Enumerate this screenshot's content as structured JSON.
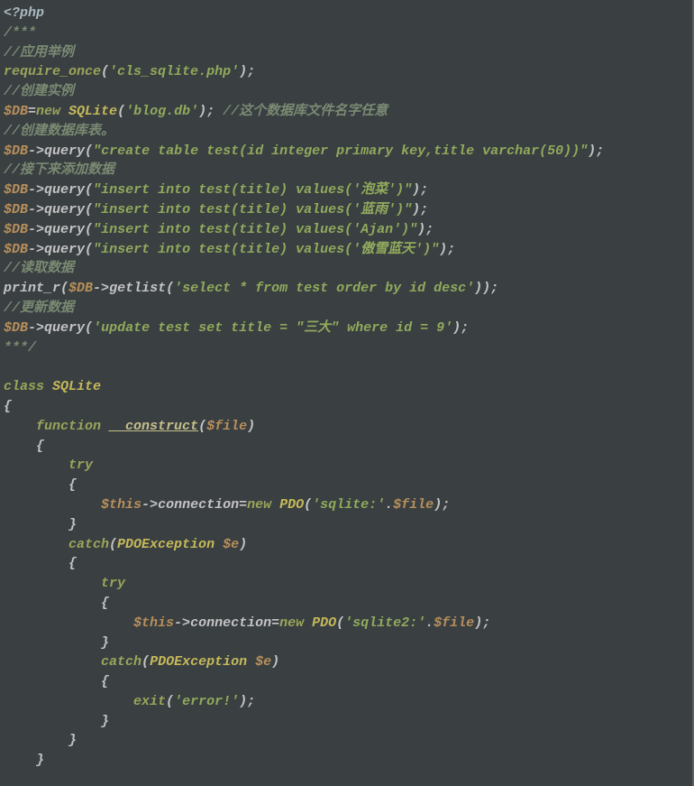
{
  "code": {
    "l1_phpopen": "<?php",
    "l2_docopen": "/***",
    "l3_c": "//应用举例",
    "l4_kw_require": "require_once",
    "l4_str": "'cls_sqlite.php'",
    "l4_end": ");",
    "l4_open": "(",
    "l5_c": "//创建实例",
    "l6_var": "$DB",
    "l6_eq": "=",
    "l6_kw_new": "new",
    "l6_cls": " SQLite",
    "l6_open": "(",
    "l6_str": "'blog.db'",
    "l6_close": "); ",
    "l6_c": "//这个数据库文件名字任意",
    "l7_c": "//创建数据库表。",
    "l8_var": "$DB",
    "l8_arrow": "->",
    "l8_m": "query",
    "l8_o": "(",
    "l8_s": "\"create table test(id integer primary key,title varchar(50))\"",
    "l8_c2": ");",
    "l9_c": "//接下来添加数据",
    "l10_var": "$DB",
    "l10_arrow": "->",
    "l10_m": "query",
    "l10_o": "(",
    "l10_s": "\"insert into test(title) values('泡菜')\"",
    "l10_c2": ");",
    "l11_var": "$DB",
    "l11_arrow": "->",
    "l11_m": "query",
    "l11_o": "(",
    "l11_s": "\"insert into test(title) values('蓝雨')\"",
    "l11_c2": ");",
    "l12_var": "$DB",
    "l12_arrow": "->",
    "l12_m": "query",
    "l12_o": "(",
    "l12_s": "\"insert into test(title) values('Ajan')\"",
    "l12_c2": ");",
    "l13_var": "$DB",
    "l13_arrow": "->",
    "l13_m": "query",
    "l13_o": "(",
    "l13_s": "\"insert into test(title) values('傲雪蓝天')\"",
    "l13_c2": ");",
    "l14_c": "//读取数据",
    "l15_fn": "print_r",
    "l15_o": "(",
    "l15_var": "$DB",
    "l15_arrow": "->",
    "l15_m": "getlist",
    "l15_o2": "(",
    "l15_s": "'select * from test order by id desc'",
    "l15_c2": "));",
    "l16_c": "//更新数据",
    "l17_var": "$DB",
    "l17_arrow": "->",
    "l17_m": "query",
    "l17_o": "(",
    "l17_s": "'update test set title = \"三大\" where id = 9'",
    "l17_c2": ");",
    "l18_docclose": "***/",
    "l19_empty": "",
    "l20_kw_class": "class",
    "l20_cls": " SQLite",
    "l21_brace": "{",
    "l22_ind": "    ",
    "l22_kw_fn": "function",
    "l22_sp": " ",
    "l22_name": "__construct",
    "l22_o": "(",
    "l22_var": "$file",
    "l22_c2": ")",
    "l23_ind": "    ",
    "l23_brace": "{",
    "l24_ind": "        ",
    "l24_kw": "try",
    "l25_ind": "        ",
    "l25_brace": "{",
    "l26_ind": "            ",
    "l26_var": "$this",
    "l26_arrow": "->",
    "l26_m": "connection",
    "l26_eq": "=",
    "l26_kw_new": "new",
    "l26_cls": " PDO",
    "l26_o": "(",
    "l26_s": "'sqlite:'",
    "l26_dot": ".",
    "l26_var2": "$file",
    "l26_c2": ");",
    "l27_ind": "        ",
    "l27_brace": "}",
    "l28_ind": "        ",
    "l28_kw": "catch",
    "l28_o": "(",
    "l28_cls": "PDOException",
    "l28_sp": " ",
    "l28_var": "$e",
    "l28_c2": ")",
    "l29_ind": "        ",
    "l29_brace": "{",
    "l30_ind": "            ",
    "l30_kw": "try",
    "l31_ind": "            ",
    "l31_brace": "{",
    "l32_ind": "                ",
    "l32_var": "$this",
    "l32_arrow": "->",
    "l32_m": "connection",
    "l32_eq": "=",
    "l32_kw_new": "new",
    "l32_cls": " PDO",
    "l32_o": "(",
    "l32_s": "'sqlite2:'",
    "l32_dot": ".",
    "l32_var2": "$file",
    "l32_c2": ");",
    "l33_ind": "            ",
    "l33_brace": "}",
    "l34_ind": "            ",
    "l34_kw": "catch",
    "l34_o": "(",
    "l34_cls": "PDOException",
    "l34_sp": " ",
    "l34_var": "$e",
    "l34_c2": ")",
    "l35_ind": "            ",
    "l35_brace": "{",
    "l36_ind": "                ",
    "l36_kw": "exit",
    "l36_o": "(",
    "l36_s": "'error!'",
    "l36_c2": ");",
    "l37_ind": "            ",
    "l37_brace": "}",
    "l38_ind": "        ",
    "l38_brace": "}",
    "l39_ind": "    ",
    "l39_brace": "}"
  }
}
